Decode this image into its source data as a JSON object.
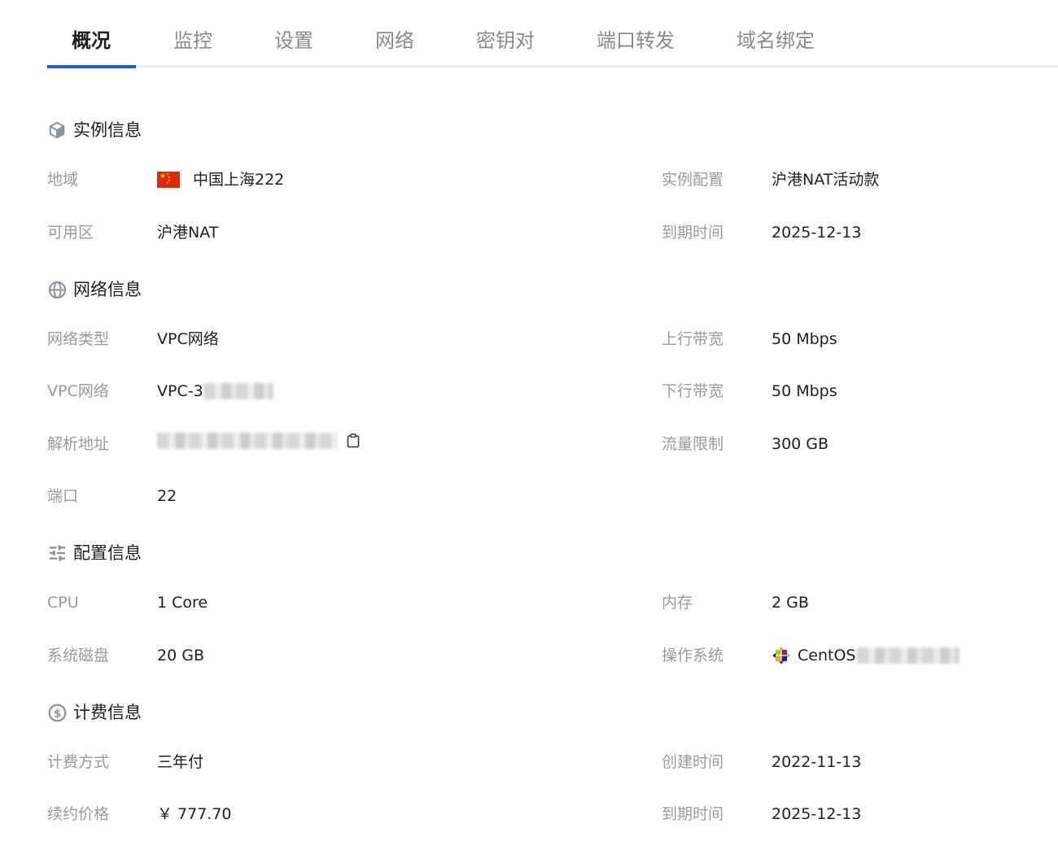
{
  "tabs": [
    {
      "label": "概况",
      "active": true
    },
    {
      "label": "监控",
      "active": false
    },
    {
      "label": "设置",
      "active": false
    },
    {
      "label": "网络",
      "active": false
    },
    {
      "label": "密钥对",
      "active": false
    },
    {
      "label": "端口转发",
      "active": false
    },
    {
      "label": "域名绑定",
      "active": false
    }
  ],
  "colors": {
    "accent": "#1e5fd0",
    "label": "#9a9a9a",
    "text": "#1f1f1f",
    "icon": "#8c949e"
  },
  "instance": {
    "title": "实例信息",
    "icon": "cube-icon",
    "region_label": "地域",
    "region_flag": "china-flag-icon",
    "region_value": "中国上海222",
    "spec_label": "实例配置",
    "spec_value": "沪港NAT活动款",
    "zone_label": "可用区",
    "zone_value": "沪港NAT",
    "expire_label": "到期时间",
    "expire_value": "2025-12-13"
  },
  "network": {
    "title": "网络信息",
    "icon": "globe-icon",
    "type_label": "网络类型",
    "type_value": "VPC网络",
    "upload_label": "上行带宽",
    "upload_value": "50 Mbps",
    "vpc_label": "VPC网络",
    "vpc_value": "VPC-3",
    "download_label": "下行带宽",
    "download_value": "50 Mbps",
    "resolve_label": "解析地址",
    "resolve_copy_icon": "copy-icon",
    "traffic_label": "流量限制",
    "traffic_value": "300 GB",
    "port_label": "端口",
    "port_value": "22"
  },
  "config": {
    "title": "配置信息",
    "icon": "sliders-icon",
    "cpu_label": "CPU",
    "cpu_value": "1 Core",
    "memory_label": "内存",
    "memory_value": "2 GB",
    "disk_label": "系统磁盘",
    "disk_value": "20 GB",
    "os_label": "操作系统",
    "os_icon": "centos-icon",
    "os_value": "CentOS"
  },
  "billing": {
    "title": "计费信息",
    "icon": "dollar-coin-icon",
    "method_label": "计费方式",
    "method_value": "三年付",
    "created_label": "创建时间",
    "created_value": "2022-11-13",
    "renew_label": "续约价格",
    "renew_value": "￥ 777.70",
    "expire_label": "到期时间",
    "expire_value": "2025-12-13"
  }
}
